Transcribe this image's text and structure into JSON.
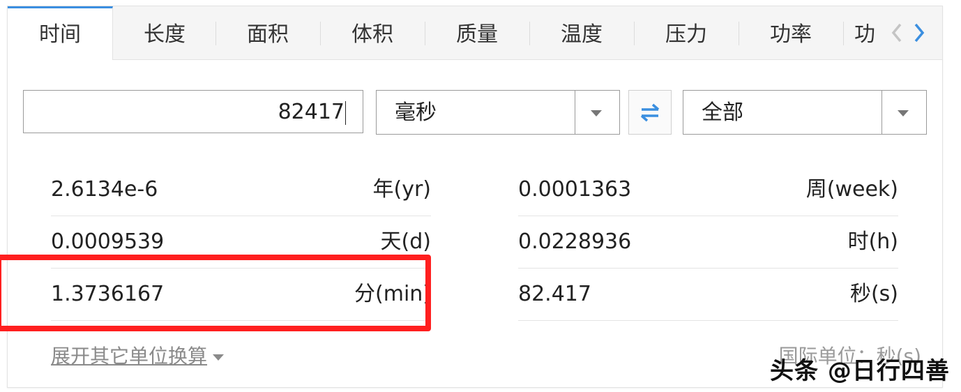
{
  "tabs": [
    {
      "label": "时间",
      "active": true
    },
    {
      "label": "长度"
    },
    {
      "label": "面积"
    },
    {
      "label": "体积"
    },
    {
      "label": "质量"
    },
    {
      "label": "温度"
    },
    {
      "label": "压力"
    },
    {
      "label": "功率"
    },
    {
      "label": "功"
    }
  ],
  "input": {
    "value": "82417"
  },
  "from_unit": {
    "selected": "毫秒"
  },
  "to_unit": {
    "selected": "全部"
  },
  "results": {
    "left": [
      {
        "value": "2.6134e-6",
        "unit": "年(yr)"
      },
      {
        "value": "0.0009539",
        "unit": "天(d)"
      },
      {
        "value": "1.3736167",
        "unit": "分(min)"
      }
    ],
    "right": [
      {
        "value": "0.0001363",
        "unit": "周(week)"
      },
      {
        "value": "0.0228936",
        "unit": "时(h)"
      },
      {
        "value": "82.417",
        "unit": "秒(s)"
      }
    ]
  },
  "expand_label": "展开其它单位换算",
  "si_note": "国际单位：秒(s)",
  "watermark": "头条 @日行四善",
  "colors": {
    "accent": "#3b8fe0",
    "highlight": "#ff1f1f"
  }
}
